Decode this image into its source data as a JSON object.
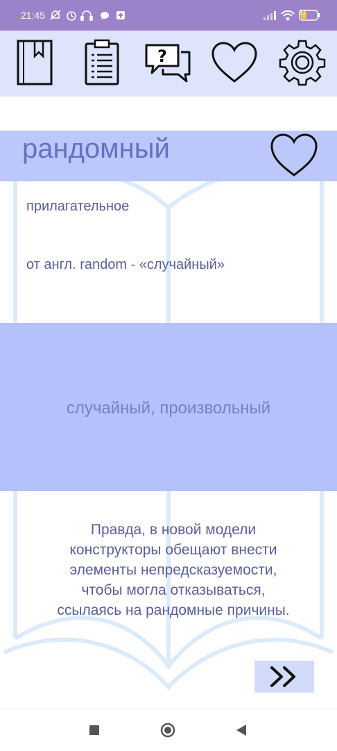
{
  "status_bar": {
    "time": "21:45",
    "battery": "27",
    "icons": [
      "mute-icon",
      "alarm-icon",
      "headset-icon",
      "chat-icon",
      "upload-icon",
      "signal-icon",
      "wifi-icon",
      "battery-icon"
    ]
  },
  "toolbar": {
    "items": [
      "book-icon",
      "clipboard-icon",
      "question-chat-icon",
      "heart-icon",
      "gear-icon"
    ]
  },
  "card": {
    "word": "рандомный",
    "part_of_speech": "прилагательное",
    "origin": "от англ. random - «случайный»",
    "meaning": "случайный, произвольный",
    "example_lines": [
      "Правда, в новой модели",
      "конструкторы обещают внести",
      "элементы непредсказуемости,",
      "чтобы могла отказываться,",
      "ссылаясь на рандомные причины."
    ]
  },
  "colors": {
    "status_bar": "#9b82c9",
    "toolbar": "#dde4fb",
    "word_band": "#bcc8fb",
    "meaning_band": "#b4c1fa",
    "text": "#5a5f9a"
  }
}
